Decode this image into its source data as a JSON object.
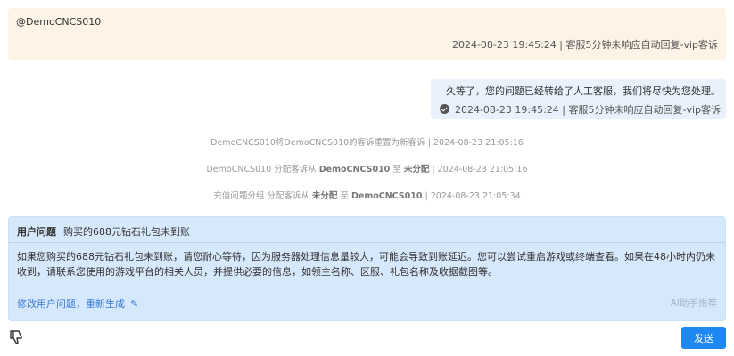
{
  "top_message": {
    "sender": "@DemoCNCS010",
    "meta": "2024-08-23 19:45:24 | 客服5分钟未响应自动回复-vip客诉"
  },
  "agent_bubble": {
    "text": "久等了，您的问题已经转给了人工客服，我们将尽快为您处理。",
    "meta": "2024-08-23 19:45:24 | 客服5分钟未响应自动回复-vip客诉"
  },
  "system_logs": [
    {
      "pre": "DemoCNCS010将DemoCNCS010的客诉重置为新客诉 | 2024-08-23 21:05:16"
    },
    {
      "pre": "DemoCNCS010 分配客诉从 ",
      "b1": "DemoCNCS010",
      "mid": " 至 ",
      "b2": "未分配",
      "post": " | 2024-08-23 21:05:16"
    },
    {
      "pre": "充值问题分组 分配客诉从 ",
      "b1": "未分配",
      "mid": " 至 ",
      "b2": "DemoCNCS010",
      "post": " | 2024-08-23 21:05:34"
    }
  ],
  "ai_panel": {
    "question_label": "用户问题",
    "question": "购买的688元钻石礼包未到账",
    "answer": "如果您购买的688元钻石礼包未到账，请您耐心等待，因为服务器处理信息量较大，可能会导致到账延迟。您可以尝试重启游戏或终端查看。如果在48小时内仍未收到，请联系您使用的游戏平台的相关人员，并提供必要的信息，如领主名称、区服、礼包名称及收据截图等。",
    "edit_label": "修改用户问题，",
    "regen_label": "重新生成",
    "credit": "AI助手推荐"
  },
  "footer": {
    "send_label": "发送"
  },
  "icons": {
    "check": "check-circle-icon",
    "edit": "pencil-icon",
    "feedback": "thumbs-down-icon"
  }
}
